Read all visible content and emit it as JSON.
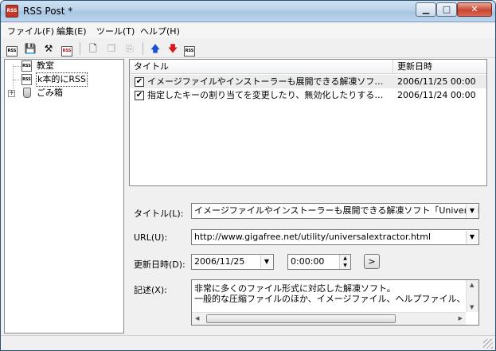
{
  "window": {
    "title": "RSS Post *",
    "icon_text": "RSS"
  },
  "menubar": {
    "items": [
      "ファイル(F)",
      "編集(E)",
      "ツール(T)",
      "ヘルプ(H)"
    ]
  },
  "toolbar": {
    "buttons": [
      "new-feed-icon",
      "save-icon",
      "tools-icon",
      "delete-icon",
      "new-document-icon",
      "copy-icon",
      "paste-icon",
      "move-up-icon",
      "move-down-icon",
      "rss-export-icon"
    ]
  },
  "tree": {
    "items": [
      {
        "label": "教室"
      },
      {
        "label": "k本的にRSS"
      },
      {
        "label": "ごみ箱"
      }
    ]
  },
  "list": {
    "columns": [
      "タイトル",
      "更新日時"
    ],
    "rows": [
      {
        "checked": true,
        "title": "イメージファイルやインストーラーも展開できる解凍ソフト「U...",
        "date": "2006/11/25 00:00"
      },
      {
        "checked": true,
        "title": "指定したキーの割り当てを変更したり、無効化したりすること...",
        "date": "2006/11/24 00:00"
      }
    ]
  },
  "details": {
    "title_label": "タイトル(L):",
    "title_value": "イメージファイルやインストーラーも展開できる解凍ソフト「Universal",
    "url_label": "URL(U):",
    "url_value": "http://www.gigafree.net/utility/universalextractor.html",
    "date_label": "更新日時(D):",
    "date_value": "2006/11/25",
    "time_value": "0:00:00",
    "nav_button": ">",
    "desc_label": "記述(X):",
    "desc_lines": [
      "非常に多くのファイル形式に対応した解凍ソフト。",
      "一般的な圧縮ファイルのほか、イメージファイル、ヘルプファイル、イ"
    ]
  }
}
